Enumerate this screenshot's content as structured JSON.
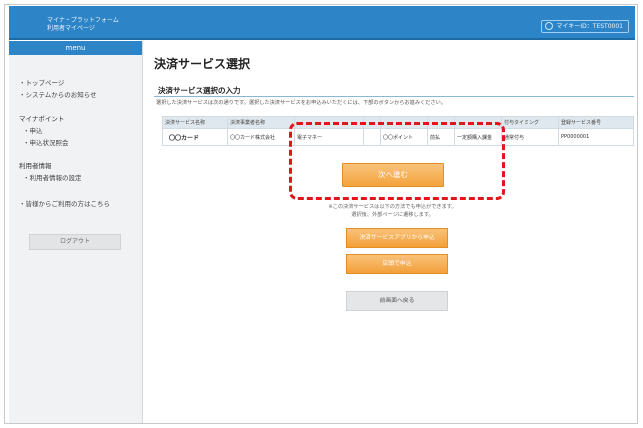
{
  "header": {
    "logo_line1": "マイナ・プラットフォーム",
    "logo_line2": "利用者マイページ",
    "user_label": "マイキーID：TEST0001"
  },
  "sidebar": {
    "menu_title": "menu",
    "items": [
      {
        "label": "・トップページ"
      },
      {
        "label": "・システムからのお知らせ"
      }
    ],
    "groups": [
      {
        "title": "マイナポイント",
        "items": [
          {
            "label": "・申込"
          },
          {
            "label": "・申込状況照会"
          }
        ]
      },
      {
        "title": "利用者情報",
        "items": [
          {
            "label": "・利用者情報の設定"
          }
        ]
      }
    ],
    "help_link": "・皆様からご利用の方はこちら",
    "logout_label": "ログアウト"
  },
  "main": {
    "title": "決済サービス選択",
    "section_title": "決済サービス選択の入力",
    "description": "選択した決済サービスは次の通りです。選択した決済サービスをお申込みいただくには、下部のボタンからお進みください。",
    "table": {
      "headers": [
        "決済サービス名称",
        "決済事業者名称",
        "",
        "",
        "",
        "",
        "",
        "付与タイミング",
        "登録サービス番号"
      ],
      "row": [
        "〇〇カード",
        "〇〇カード株式会社",
        "電子マネー",
        "",
        "〇〇ポイント",
        "前払",
        "一定額購入課金",
        "通常付与",
        "PP0000001"
      ]
    },
    "next_button": "次へ進む",
    "note_line1": "※この決済サービスは以下の方法でも申込ができます。",
    "note_line2": "選択後、外部ページに遷移します。",
    "app_button": "決済サービスアプリから申込",
    "store_button": "店頭で申込",
    "back_button": "前画面へ戻る"
  },
  "colors": {
    "header_blue": "#2d84c6",
    "accent_orange": "#f3a43e",
    "highlight_red": "#e4141a"
  }
}
